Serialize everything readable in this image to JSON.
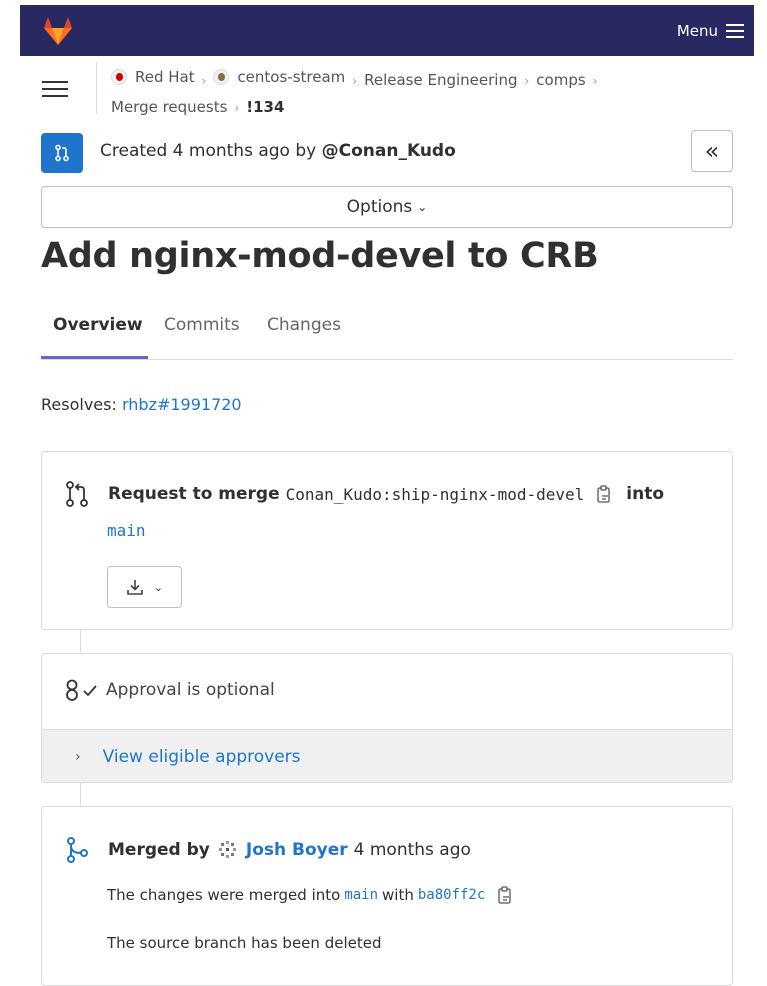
{
  "navbar": {
    "menu_label": "Menu",
    "logo_icon": "gitlab-logo",
    "bg_color": "#292961"
  },
  "breadcrumbs": {
    "items": [
      "Red Hat",
      "centos-stream",
      "Release Engineering",
      "comps",
      "Merge requests",
      "!134"
    ]
  },
  "status": {
    "created_prefix": "Created 4 months ago by",
    "author": "@Conan_Kudo",
    "collapse_icon": "double-chevron-left-icon"
  },
  "options": {
    "label": "Options"
  },
  "title": "Add nginx-mod-devel to CRB",
  "tabs": [
    {
      "label": "Overview",
      "active": true
    },
    {
      "label": "Commits",
      "active": false
    },
    {
      "label": "Changes",
      "active": false
    }
  ],
  "resolves": {
    "prefix": "Resolves:",
    "link": "rhbz#1991720"
  },
  "merge_request": {
    "label": "Request to merge",
    "source_branch": "Conan_Kudo:ship-nginx-mod-devel",
    "into_label": "into",
    "target_branch": "main"
  },
  "approval": {
    "status": "Approval is optional",
    "view_approvers": "View eligible approvers"
  },
  "merged": {
    "label": "Merged by",
    "user": "Josh Boyer",
    "time": "4 months ago",
    "line_prefix": "The changes were merged into",
    "branch": "main",
    "with_label": "with",
    "commit": "ba80ff2c",
    "deleted": "The source branch has been deleted"
  },
  "colors": {
    "accent": "#1f75cb",
    "tab_active": "#6666c4"
  }
}
